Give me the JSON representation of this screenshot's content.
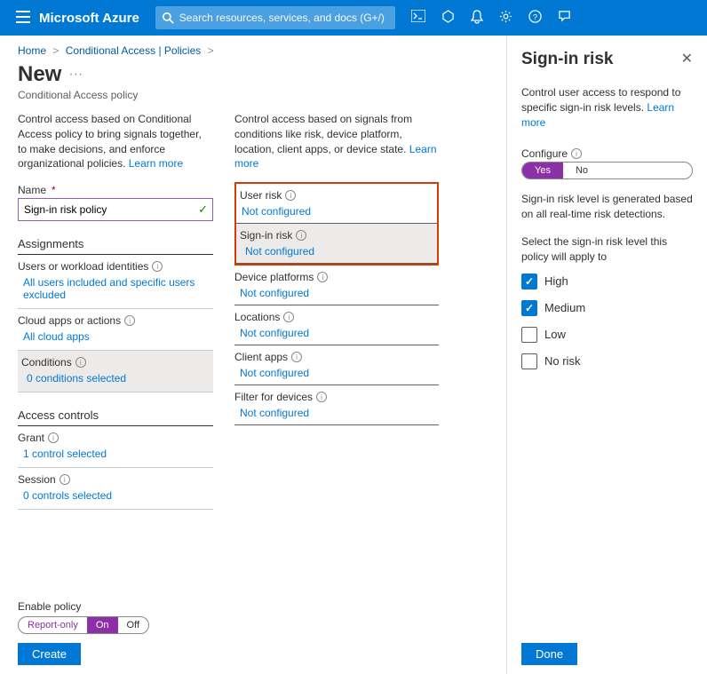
{
  "header": {
    "brand": "Microsoft Azure",
    "searchPlaceholder": "Search resources, services, and docs (G+/)"
  },
  "breadcrumb": {
    "home": "Home",
    "policies": "Conditional Access | Policies"
  },
  "page": {
    "title": "New",
    "subtitle": "Conditional Access policy"
  },
  "colA": {
    "intro": "Control access based on Conditional Access policy to bring signals together, to make decisions, and enforce organizational policies.",
    "learnMore": "Learn more",
    "nameLabel": "Name",
    "nameValue": "Sign-in risk policy",
    "assignmentsHdr": "Assignments",
    "users": {
      "label": "Users or workload identities",
      "value": "All users included and specific users excluded"
    },
    "apps": {
      "label": "Cloud apps or actions",
      "value": "All cloud apps"
    },
    "cond": {
      "label": "Conditions",
      "value": "0 conditions selected"
    },
    "accessHdr": "Access controls",
    "grant": {
      "label": "Grant",
      "value": "1 control selected"
    },
    "session": {
      "label": "Session",
      "value": "0 controls selected"
    }
  },
  "colB": {
    "intro": "Control access based on signals from conditions like risk, device platform, location, client apps, or device state.",
    "learnMore": "Learn more",
    "userRisk": {
      "label": "User risk",
      "value": "Not configured"
    },
    "signInRisk": {
      "label": "Sign-in risk",
      "value": "Not configured"
    },
    "devicePlatforms": {
      "label": "Device platforms",
      "value": "Not configured"
    },
    "locations": {
      "label": "Locations",
      "value": "Not configured"
    },
    "clientApps": {
      "label": "Client apps",
      "value": "Not configured"
    },
    "filter": {
      "label": "Filter for devices",
      "value": "Not configured"
    }
  },
  "footer": {
    "enableLabel": "Enable policy",
    "opts": {
      "reportOnly": "Report-only",
      "on": "On",
      "off": "Off"
    },
    "create": "Create"
  },
  "panel": {
    "title": "Sign-in risk",
    "desc": "Control user access to respond to specific sign-in risk levels.",
    "learnMore": "Learn more",
    "configure": "Configure",
    "yes": "Yes",
    "no": "No",
    "note": "Sign-in risk level is generated based on all real-time risk detections.",
    "select": "Select the sign-in risk level this policy will apply to",
    "levels": {
      "high": "High",
      "medium": "Medium",
      "low": "Low",
      "noRisk": "No risk"
    },
    "done": "Done"
  }
}
